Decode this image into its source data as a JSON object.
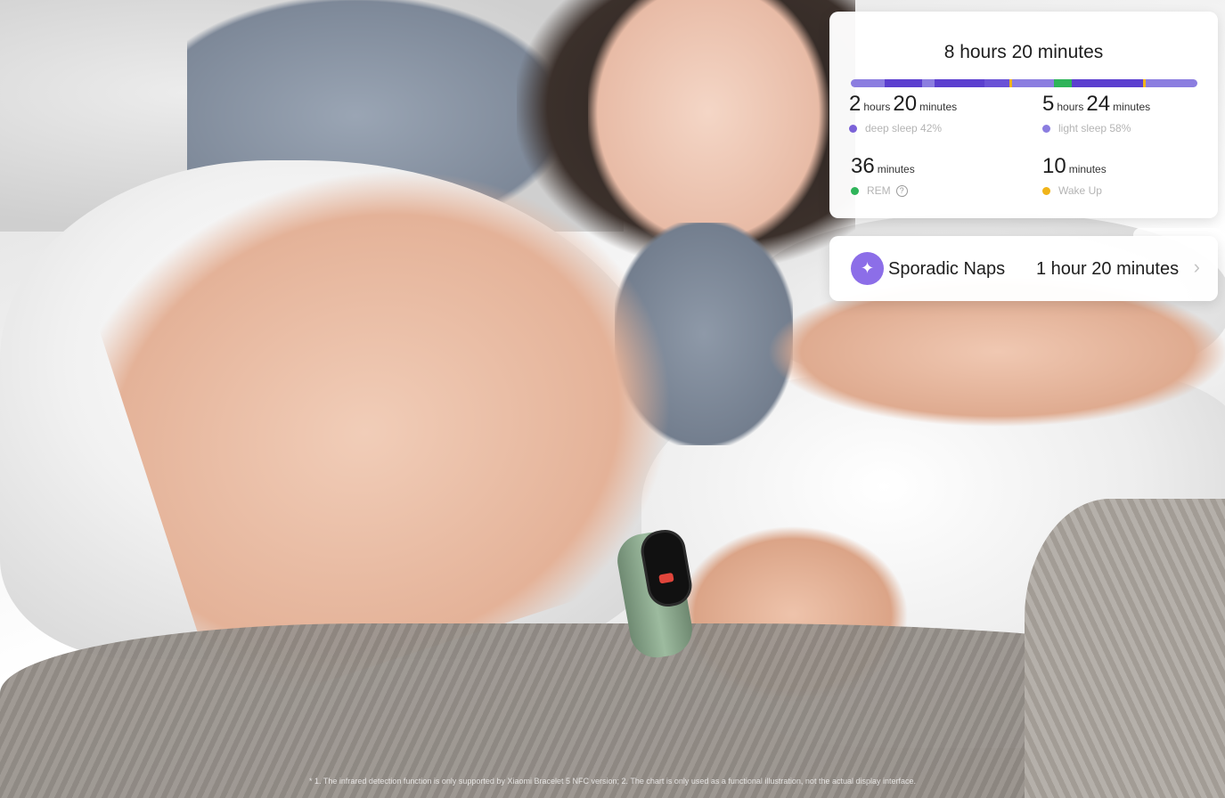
{
  "sleep_card": {
    "total": "8 hours 20 minutes",
    "bar_colors": {
      "light": "#8b7de0",
      "deep": "#5b3fcf",
      "rem": "#2fb45a",
      "wake": "#f0b419"
    },
    "stats": [
      {
        "num1": "2",
        "unit1": "hours",
        "num2": "20",
        "unit2": "minutes",
        "label": "deep sleep 42%",
        "dot_color": "#7b62d8"
      },
      {
        "num1": "5",
        "unit1": "hours",
        "num2": "24",
        "unit2": "minutes",
        "label": "light sleep 58%",
        "dot_color": "#8b7de0"
      },
      {
        "num1": "36",
        "unit1": "minutes",
        "label": "REM",
        "dot_color": "#2fb45a"
      },
      {
        "num1": "10",
        "unit1": "minutes",
        "label": "Wake Up",
        "dot_color": "#f0b419"
      }
    ]
  },
  "naps_card": {
    "icon": "sparkle-icon",
    "title": "Sporadic Naps",
    "duration": "1 hour 20 minutes",
    "chevron": "chevron-right-icon"
  },
  "disclaimer": "* 1. The infrared detection function is only supported by Xiaomi Bracelet 5 NFC version; 2. The chart is only used as a functional illustration, not the actual display interface."
}
